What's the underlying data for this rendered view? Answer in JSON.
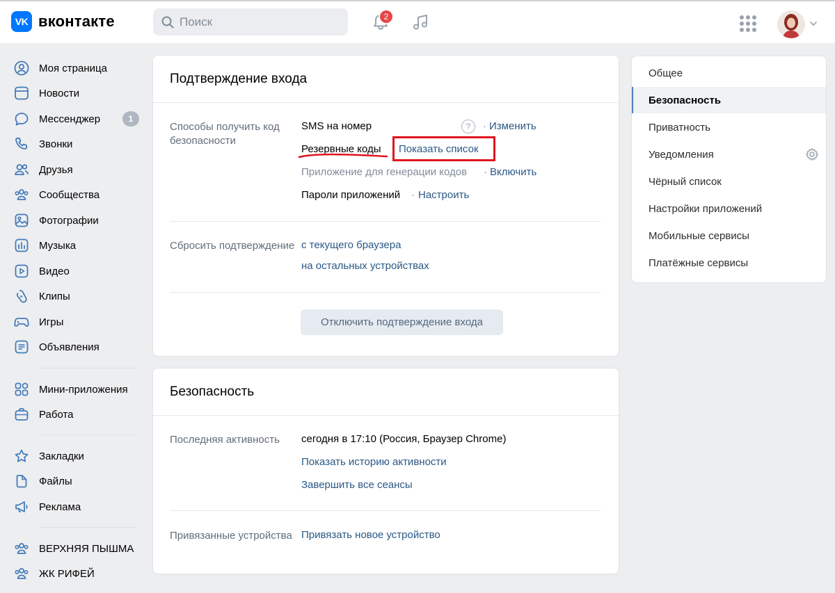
{
  "brand": {
    "logo_mark": "VK",
    "name": "вконтакте",
    "accent": "#0077ff"
  },
  "header": {
    "search_placeholder": "Поиск",
    "notifications_count": "2",
    "icons": [
      "search-icon",
      "bell-icon",
      "music-icon",
      "apps-grid-icon",
      "chevron-down-icon"
    ]
  },
  "leftnav": {
    "items": [
      {
        "label": "Моя страница",
        "icon": "user-circle-icon"
      },
      {
        "label": "Новости",
        "icon": "news-icon"
      },
      {
        "label": "Мессенджер",
        "icon": "chat-icon",
        "count": "1"
      },
      {
        "label": "Звонки",
        "icon": "phone-icon"
      },
      {
        "label": "Друзья",
        "icon": "friends-icon"
      },
      {
        "label": "Сообщества",
        "icon": "communities-icon"
      },
      {
        "label": "Фотографии",
        "icon": "photo-icon"
      },
      {
        "label": "Музыка",
        "icon": "music-bars-icon"
      },
      {
        "label": "Видео",
        "icon": "video-icon"
      },
      {
        "label": "Клипы",
        "icon": "clips-icon"
      },
      {
        "label": "Игры",
        "icon": "gamepad-icon"
      },
      {
        "label": "Объявления",
        "icon": "ads-list-icon"
      },
      {
        "label": "Мини-приложения",
        "icon": "mini-apps-icon"
      },
      {
        "label": "Работа",
        "icon": "briefcase-icon"
      },
      {
        "label": "Закладки",
        "icon": "star-icon"
      },
      {
        "label": "Файлы",
        "icon": "file-icon"
      },
      {
        "label": "Реклама",
        "icon": "megaphone-icon"
      },
      {
        "label": "ВЕРХНЯЯ ПЫШМА",
        "icon": "group-icon"
      },
      {
        "label": "ЖК РИФЕЙ",
        "icon": "group-icon"
      }
    ]
  },
  "login_confirm": {
    "title": "Подтверждение входа",
    "methods_label": "Способы получить код безопасности",
    "sms_label": "SMS на номер",
    "sms_help": "?",
    "sms_action": "Изменить",
    "backup_codes_label": "Резервные коды",
    "backup_codes_action": "Показать список",
    "app_generator_label": "Приложение для генерации кодов",
    "app_generator_action": "Включить",
    "app_passwords_label": "Пароли приложений",
    "app_passwords_action": "Настроить",
    "dot": "·",
    "reset_label": "Сбросить подтверждение",
    "reset_current": "с текущего браузера",
    "reset_others": "на остальных устройствах",
    "disable_button": "Отключить подтверждение входа"
  },
  "security": {
    "title": "Безопасность",
    "last_activity_label": "Последняя активность",
    "last_activity_value": "сегодня в 17:10 (Россия, Браузер Chrome)",
    "show_history": "Показать историю активности",
    "end_sessions": "Завершить все сеансы",
    "devices_label": "Привязанные устройства",
    "add_device": "Привязать новое устройство"
  },
  "settings_menu": {
    "items": [
      {
        "label": "Общее"
      },
      {
        "label": "Безопасность",
        "active": true
      },
      {
        "label": "Приватность"
      },
      {
        "label": "Уведомления",
        "icon": "gear-icon"
      },
      {
        "label": "Чёрный список"
      },
      {
        "label": "Настройки приложений"
      },
      {
        "label": "Мобильные сервисы"
      },
      {
        "label": "Платёжные сервисы"
      }
    ]
  },
  "annotations": {
    "highlight_color": "#e0141e"
  }
}
